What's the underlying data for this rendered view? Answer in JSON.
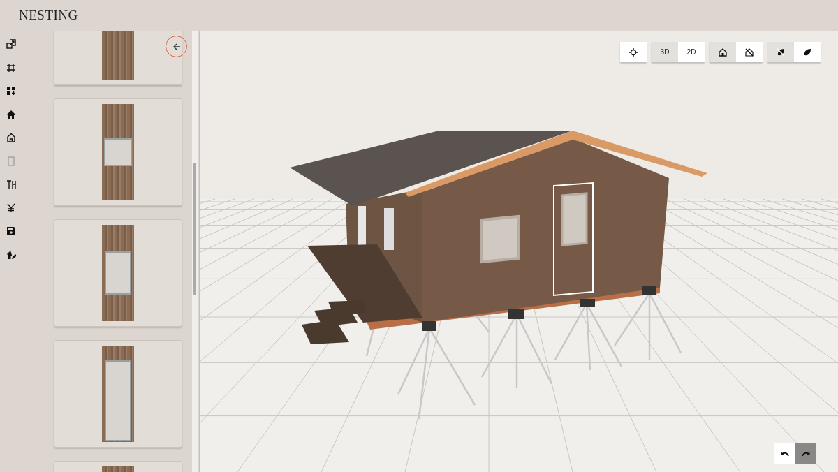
{
  "app": {
    "title": "NESTING"
  },
  "rail_items": [
    {
      "kind": "resize",
      "disabled": false
    },
    {
      "kind": "frame",
      "disabled": false
    },
    {
      "kind": "add-grid",
      "disabled": false
    },
    {
      "kind": "home",
      "disabled": false
    },
    {
      "kind": "home-outline",
      "disabled": false
    },
    {
      "kind": "door",
      "disabled": true
    },
    {
      "kind": "text-cursor",
      "disabled": false
    },
    {
      "kind": "yen",
      "disabled": false
    },
    {
      "kind": "save",
      "disabled": false
    },
    {
      "kind": "home-edit",
      "disabled": false
    }
  ],
  "panel_cards": [
    {
      "kind": "plain"
    },
    {
      "kind": "window"
    },
    {
      "kind": "tall-window"
    },
    {
      "kind": "door"
    },
    {
      "kind": "plain"
    }
  ],
  "toolbar": {
    "groups": [
      {
        "items": [
          {
            "kind": "locate",
            "selected": false
          }
        ]
      },
      {
        "items": [
          {
            "kind": "text",
            "label": "3D",
            "selected": true
          },
          {
            "kind": "text",
            "label": "2D",
            "selected": false
          }
        ]
      },
      {
        "items": [
          {
            "kind": "home",
            "selected": true
          },
          {
            "kind": "home-off",
            "selected": false
          }
        ]
      },
      {
        "items": [
          {
            "kind": "leaf-off",
            "selected": true
          },
          {
            "kind": "leaf",
            "selected": false
          }
        ]
      }
    ]
  },
  "history": [
    {
      "kind": "undo",
      "disabled": false
    },
    {
      "kind": "redo",
      "disabled": true
    }
  ]
}
